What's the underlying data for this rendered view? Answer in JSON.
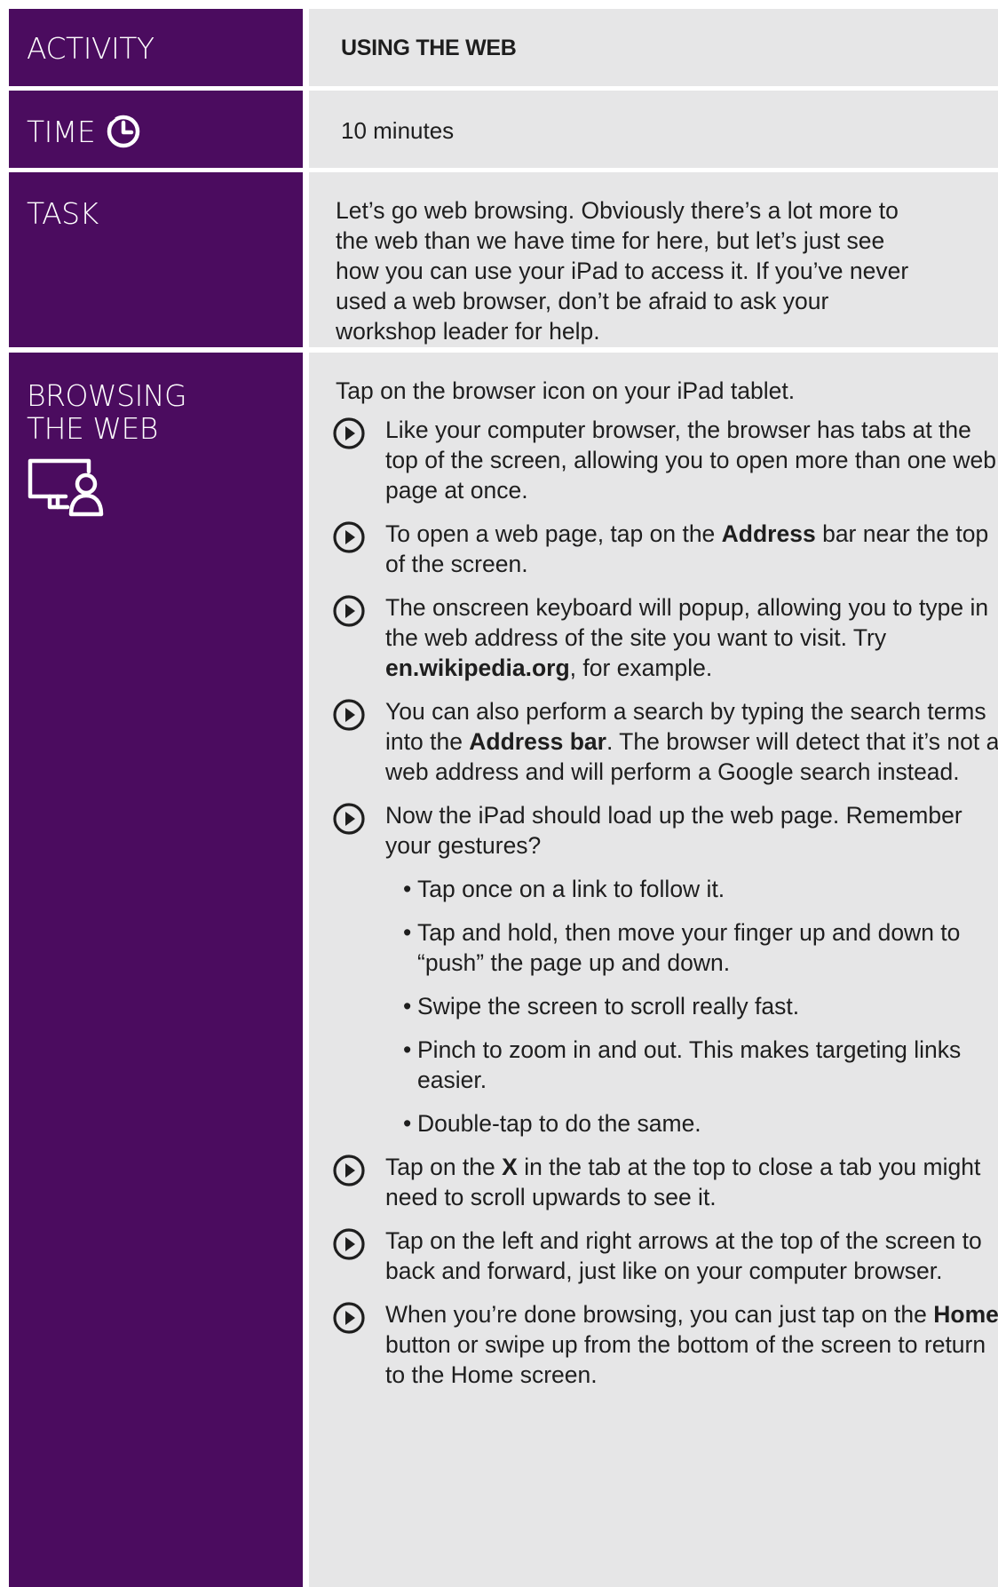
{
  "activity": {
    "label": "ACTIVITY",
    "value": "USING THE WEB"
  },
  "time": {
    "label": "TIME",
    "icon": "clock-icon",
    "value": "10 minutes"
  },
  "task": {
    "label": "TASK",
    "text": "Let’s go web browsing. Obviously there’s a lot more to the web than we have time for here, but let’s just see how you can use your iPad to access it. If you’ve never used a web browser, don’t be afraid to ask your workshop leader for help."
  },
  "browsing": {
    "label_line1": "BROWSING",
    "label_line2": "THE WEB",
    "icon": "computer-user-icon",
    "intro": "Tap on the browser icon on your iPad tablet.",
    "steps": [
      {
        "a": "Like your computer browser, the browser has tabs at the top of the screen, allowing you to open more than one web page at once."
      },
      {
        "a": "To open a web page, tap on the ",
        "b": "Address",
        "c": " bar near the top of the screen."
      },
      {
        "a": "The onscreen keyboard will popup, allowing you to type in the web address of the site you want to visit. Try ",
        "b": "en.wikipedia.org",
        "c": ", for example."
      },
      {
        "a": "You can also perform a search by typing the search terms into the ",
        "b": "Address bar",
        "c": ". The browser will detect that it’s not a web address and will perform a Google search instead."
      },
      {
        "a": "Now the iPad should load up the web page. Remember your gestures?"
      },
      {
        "a": "Tap on the ",
        "b": "X",
        "c": " in the tab at the top to close a tab you might need to scroll upwards to see it."
      },
      {
        "a": "Tap on the left and right arrows at the top of the screen to back and forward, just like on your computer browser."
      },
      {
        "a": "When you’re done browsing, you can just tap on the ",
        "b": "Home",
        "c": " button or swipe up from the bottom of the screen to return to the Home screen."
      }
    ],
    "gestures": [
      "Tap once on a link to follow it.",
      "Tap and hold, then move your finger up and down to “push” the page up and down.",
      "Swipe the screen to scroll really fast.",
      "Pinch to zoom in and out. This makes targeting links easier.",
      "Double-tap to do the same."
    ],
    "bullet": "•"
  },
  "colors": {
    "left_panel": "#4b0c5f",
    "right_panel": "#e6e6e7",
    "text": "#1e1e1e"
  }
}
